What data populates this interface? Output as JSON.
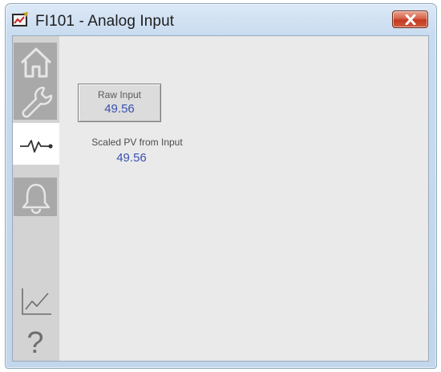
{
  "window": {
    "title": "FI101 - Analog Input"
  },
  "sidebar": {
    "items": [
      {
        "name": "home",
        "icon": "home-icon"
      },
      {
        "name": "maintenance",
        "icon": "wrench-icon"
      },
      {
        "name": "engineering",
        "icon": "signal-icon",
        "active": true
      },
      {
        "name": "alarms",
        "icon": "bell-icon"
      },
      {
        "name": "trends",
        "icon": "trend-chart-icon"
      },
      {
        "name": "help",
        "icon": "question-icon"
      }
    ]
  },
  "main": {
    "raw_input_label": "Raw Input",
    "raw_input_value": "49.56",
    "scaled_pv_label": "Scaled PV from Input",
    "scaled_pv_value": "49.56"
  },
  "colors": {
    "value_text": "#3a51b0",
    "close_button": "#c43a22",
    "active_tab": "#ffffff",
    "inactive_tab": "#a9a9a9"
  }
}
